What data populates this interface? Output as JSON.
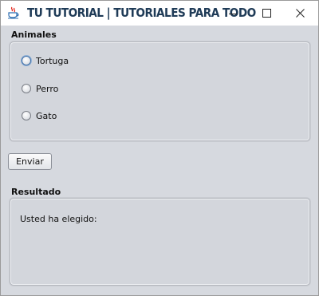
{
  "window": {
    "title": "TU TUTORIAL | TUTORIALES PARA TODO",
    "app_icon": "java-coffee-icon",
    "controls": {
      "minimize": "minimize-icon",
      "maximize": "maximize-icon",
      "close": "close-icon"
    }
  },
  "animals_group": {
    "label": "Animales",
    "options": [
      {
        "label": "Tortuga",
        "selected": false,
        "focused": true
      },
      {
        "label": "Perro",
        "selected": false
      },
      {
        "label": "Gato",
        "selected": false
      }
    ]
  },
  "submit_button": {
    "label": "Enviar"
  },
  "result_group": {
    "label": "Resultado",
    "text": "Usted ha elegido:"
  },
  "colors": {
    "title_text": "#1f3b57",
    "window_background": "#d6d9df",
    "focus_ring": "#3f6fa8"
  }
}
